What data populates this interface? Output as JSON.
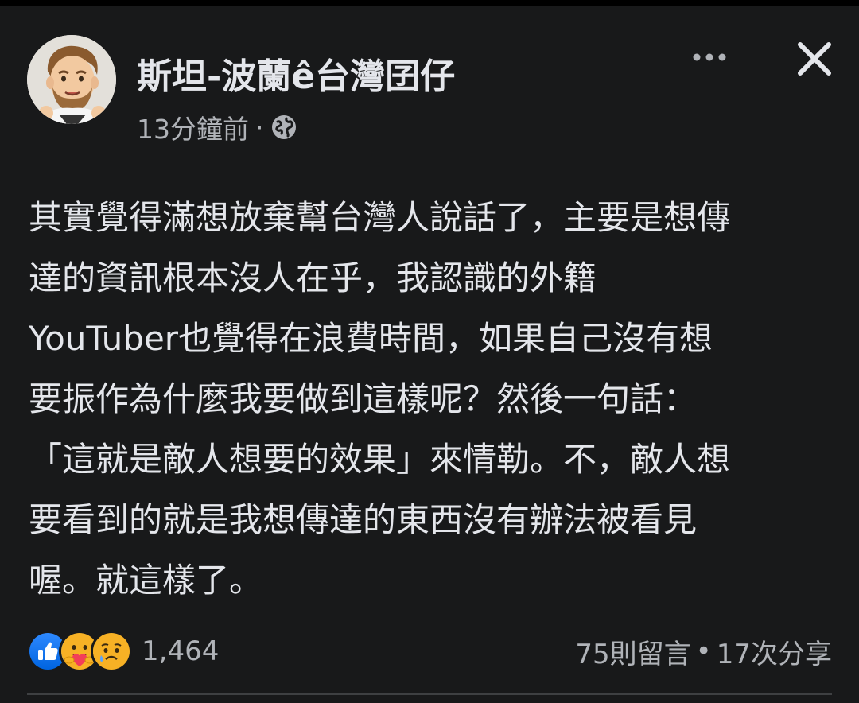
{
  "post": {
    "author": "斯坦-波蘭ê台灣囝仔",
    "timestamp": "13分鐘前",
    "meta_separator": "·",
    "audience_icon": "globe-icon",
    "text_lines": [
      "其實覺得滿想放棄幫台灣人說話了，主要是想傳",
      "達的資訊根本沒人在乎，我認識的外籍",
      "YouTuber也覺得在浪費時間，如果自己沒有想",
      "要振作為什麼我要做到這樣呢？然後一句話：",
      "「這就是敵人想要的效果」來情勒。不，敵人想",
      "要看到的就是我想傳達的東西沒有辦法被看見",
      "喔。就這樣了。"
    ]
  },
  "header": {
    "more_icon": "more-options-icon",
    "close_icon": "close-icon"
  },
  "reactions": {
    "icons": [
      "like-icon",
      "care-icon",
      "sad-icon"
    ],
    "count": "1,464"
  },
  "engagement": {
    "comments": "75則留言",
    "separator": "•",
    "shares": "17次分享"
  },
  "colors": {
    "background": "#18191a",
    "primary_text": "#e4e6eb",
    "secondary_text": "#b0b3b8",
    "like_blue": "#1877f2",
    "reaction_yellow": "#f7b125"
  }
}
